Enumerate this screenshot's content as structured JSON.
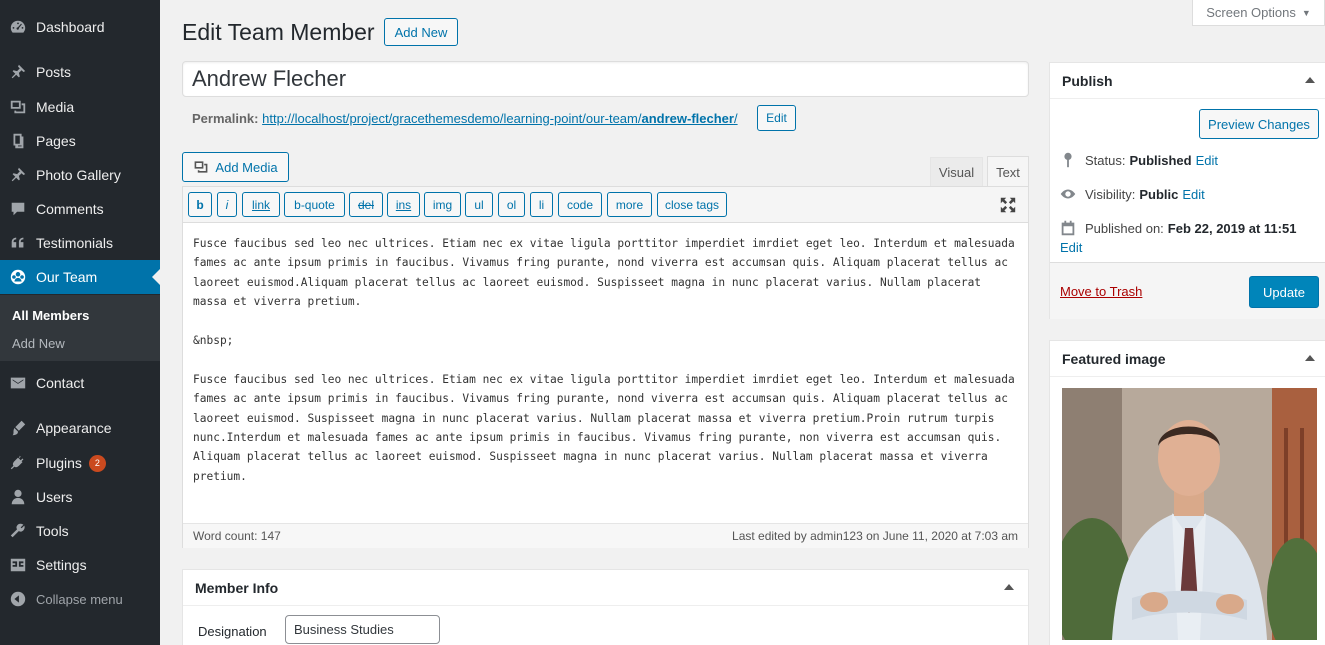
{
  "sidebar": {
    "items": [
      {
        "label": "Dashboard",
        "icon": "dashboard-icon"
      },
      {
        "label": "Posts",
        "icon": "pin-icon"
      },
      {
        "label": "Media",
        "icon": "media-icon"
      },
      {
        "label": "Pages",
        "icon": "pages-icon"
      },
      {
        "label": "Photo Gallery",
        "icon": "pin-icon"
      },
      {
        "label": "Comments",
        "icon": "comment-icon"
      },
      {
        "label": "Testimonials",
        "icon": "quote-icon"
      },
      {
        "label": "Our Team",
        "icon": "team-icon"
      },
      {
        "label": "Contact",
        "icon": "mail-icon"
      },
      {
        "label": "Appearance",
        "icon": "brush-icon"
      },
      {
        "label": "Plugins",
        "icon": "plug-icon",
        "badge": "2"
      },
      {
        "label": "Users",
        "icon": "user-icon"
      },
      {
        "label": "Tools",
        "icon": "wrench-icon"
      },
      {
        "label": "Settings",
        "icon": "settings-icon"
      }
    ],
    "submenu": {
      "current": "All Members",
      "other": "Add New"
    },
    "collapse_label": "Collapse menu"
  },
  "screen_options": "Screen Options",
  "header": {
    "title": "Edit Team Member",
    "add_new": "Add New"
  },
  "post_title": "Andrew Flecher",
  "permalink": {
    "label": "Permalink:",
    "base": "http://localhost/project/gracethemesdemo/learning-point/our-team/",
    "slug": "andrew-flecher",
    "trail": "/",
    "edit": "Edit"
  },
  "editor": {
    "add_media": "Add Media",
    "tab_visual": "Visual",
    "tab_text": "Text",
    "buttons": [
      "b",
      "i",
      "link",
      "b-quote",
      "del",
      "ins",
      "img",
      "ul",
      "ol",
      "li",
      "code",
      "more",
      "close tags"
    ],
    "paragraphs": [
      "Fusce faucibus sed leo nec ultrices. Etiam nec ex vitae ligula porttitor imperdiet imrdiet eget leo. Interdum et malesuada fames ac ante ipsum primis in faucibus. Vivamus fring purante, nond viverra est accumsan quis. Aliquam placerat tellus ac laoreet euismod.Aliquam placerat tellus ac laoreet euismod. Suspisseet magna in nunc placerat varius. Nullam placerat massa et viverra pretium.",
      "&nbsp;",
      "Fusce faucibus sed leo nec ultrices. Etiam nec ex vitae ligula porttitor imperdiet imrdiet eget leo. Interdum et malesuada fames ac ante ipsum primis in faucibus. Vivamus fring purante, nond viverra est accumsan quis. Aliquam placerat tellus ac laoreet euismod. Suspisseet magna in nunc placerat varius. Nullam placerat massa et viverra pretium.Proin rutrum turpis nunc.Interdum et malesuada fames ac ante ipsum primis in faucibus. Vivamus fring purante, non viverra est accumsan quis. Aliquam placerat tellus ac laoreet euismod. Suspisseet magna in nunc placerat varius. Nullam placerat massa et viverra pretium."
    ],
    "word_count": "Word count: 147",
    "last_edited": "Last edited by admin123 on June 11, 2020 at 7:03 am"
  },
  "member_info": {
    "title": "Member Info",
    "designation_label": "Designation",
    "designation_value": "Business Studies"
  },
  "publish": {
    "title": "Publish",
    "preview": "Preview Changes",
    "status_label": "Status:",
    "status_value": "Published",
    "visibility_label": "Visibility:",
    "visibility_value": "Public",
    "published_label": "Published on:",
    "published_value": "Feb 22, 2019 at 11:51",
    "edit": "Edit",
    "trash": "Move to Trash",
    "update": "Update"
  },
  "featured": {
    "title": "Featured image"
  },
  "colors": {
    "admin_bar": "#23282d",
    "active": "#0073aa",
    "primary_button": "#0085ba",
    "trash": "#aa0000"
  }
}
